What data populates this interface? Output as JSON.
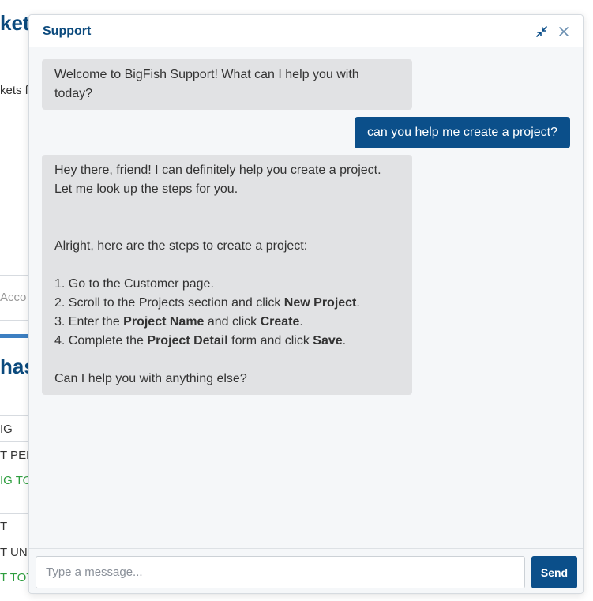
{
  "background": {
    "heading_1": "kets",
    "text_1": "kets f",
    "account_placeholder": "Acco",
    "heading_2": "has",
    "rows": [
      {
        "text": "IG",
        "status": "normal"
      },
      {
        "text": "T PEN",
        "status": "normal"
      },
      {
        "text": "IG TO",
        "status": "green"
      },
      {
        "text": "T",
        "status": "normal"
      },
      {
        "text": "T UNS",
        "status": "normal"
      },
      {
        "text": "T TOT",
        "status": "green"
      }
    ]
  },
  "chat": {
    "title": "Support",
    "icons": {
      "collapse": "collapse-arrows-icon",
      "close": "close-icon"
    },
    "colors": {
      "accent": "#0b4f8a",
      "title": "#0b4a7d",
      "bot_bubble": "#e1e2e4"
    },
    "messages": [
      {
        "sender": "bot",
        "lines": [
          "Welcome to BigFish Support! What can I help you with",
          "today?"
        ]
      },
      {
        "sender": "user",
        "text": "can you help me create a project?"
      },
      {
        "sender": "bot",
        "intro_1": "Hey there, friend! I can definitely help you create a project.",
        "intro_2": "Let me look up the steps for you.",
        "steps_intro": "Alright, here are the steps to create a project:",
        "step1": "1. Go to the Customer page.",
        "step2": {
          "a": "2. Scroll to the Projects section and click ",
          "b": "New Project",
          "c": "."
        },
        "step3": {
          "a": "3. Enter the ",
          "b": "Project Name",
          "c": " and click ",
          "d": "Create",
          "e": "."
        },
        "step4": {
          "a": "4. Complete the ",
          "b": "Project Detail",
          "c": " form and click ",
          "d": "Save",
          "e": "."
        },
        "closing": "Can I help you with anything else?"
      }
    ],
    "input": {
      "placeholder": "Type a message...",
      "value": ""
    },
    "send_label": "Send"
  }
}
